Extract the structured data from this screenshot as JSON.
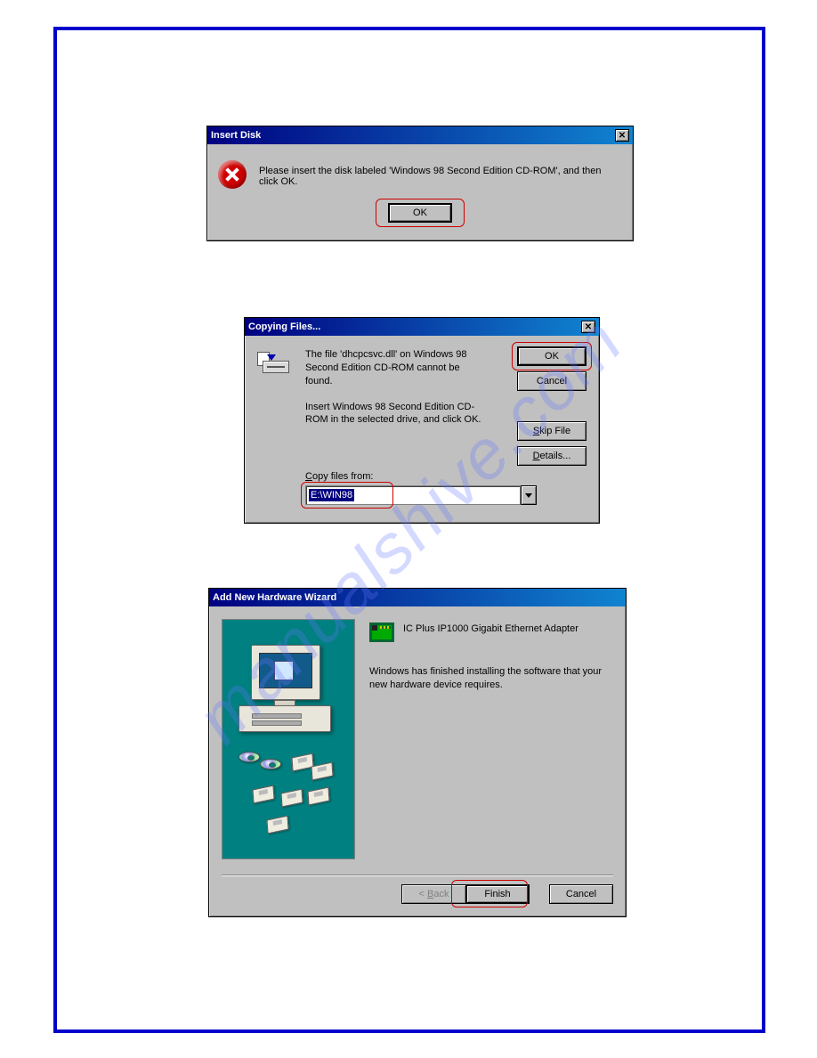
{
  "watermark": "manualshive.com",
  "dialog1": {
    "title": "Insert Disk",
    "message": "Please insert the disk labeled 'Windows 98 Second Edition CD-ROM', and then click OK.",
    "ok": "OK"
  },
  "dialog2": {
    "title": "Copying Files...",
    "line1": "The file 'dhcpcsvc.dll' on Windows 98 Second Edition CD-ROM cannot be found.",
    "line2": "Insert Windows 98 Second Edition CD-ROM in the selected drive, and click OK.",
    "copy_from_label": "Copy files from:",
    "copy_from_value": "E:\\WIN98",
    "ok": "OK",
    "cancel": "Cancel",
    "skip": "Skip File",
    "details": "Details..."
  },
  "dialog3": {
    "title": "Add New Hardware Wizard",
    "device": "IC Plus IP1000 Gigabit Ethernet Adapter",
    "finished": "Windows has finished installing the software that your new hardware device requires.",
    "back": "< Back",
    "finish": "Finish",
    "cancel": "Cancel"
  }
}
